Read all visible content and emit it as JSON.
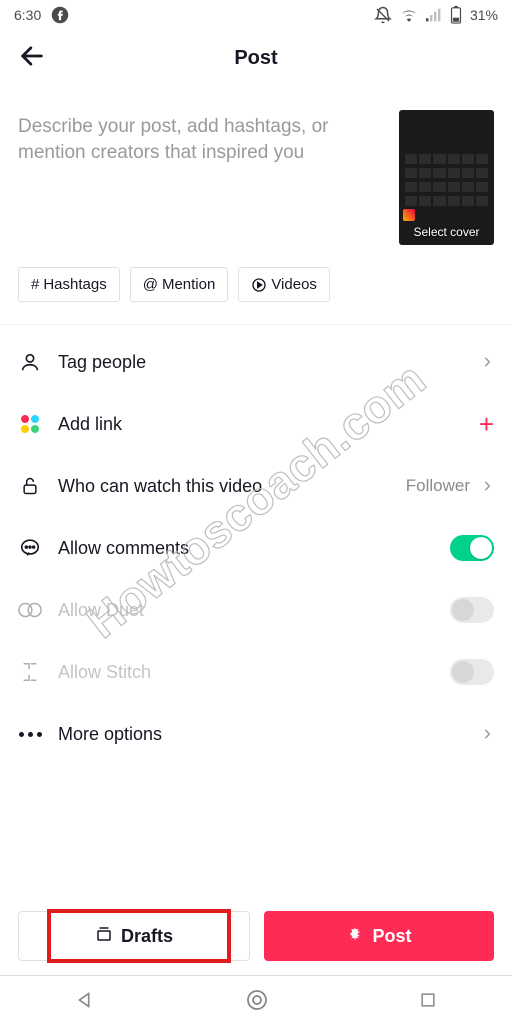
{
  "status": {
    "time": "6:30",
    "battery_pct": "31%"
  },
  "header": {
    "title": "Post"
  },
  "compose": {
    "placeholder": "Describe your post, add hashtags, or mention creators that inspired you",
    "cover_label": "Select cover"
  },
  "chips": {
    "hashtags": "Hashtags",
    "mention": "Mention",
    "videos": "Videos"
  },
  "rows": {
    "tag_people": "Tag people",
    "add_link": "Add link",
    "who_watch": "Who can watch this video",
    "who_watch_value": "Follower",
    "allow_comments": "Allow comments",
    "allow_duet": "Allow Duet",
    "allow_stitch": "Allow Stitch",
    "more_options": "More options"
  },
  "toggles": {
    "comments": true,
    "duet": false,
    "stitch": false
  },
  "buttons": {
    "drafts": "Drafts",
    "post": "Post"
  },
  "colors": {
    "brand_pink": "#fe2c55",
    "toggle_green": "#00d18b",
    "dots": [
      "#fe2c55",
      "#2dd6ff",
      "#ffcc00",
      "#3ad17f"
    ],
    "highlight_red": "#e01c1c"
  },
  "watermark": "Howtoscoach.com"
}
